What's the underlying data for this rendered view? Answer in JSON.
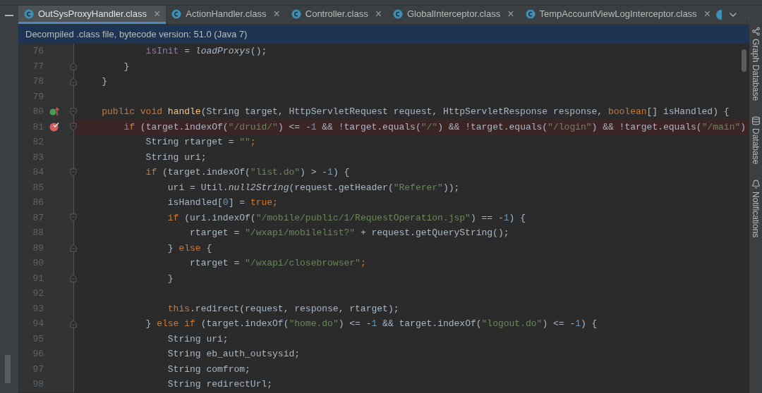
{
  "tabs": [
    {
      "label": "OutSysProxyHandler.class",
      "close": "×",
      "selected": true
    },
    {
      "label": "ActionHandler.class",
      "close": "×",
      "selected": false
    },
    {
      "label": "Controller.class",
      "close": "×",
      "selected": false
    },
    {
      "label": "GlobalInterceptor.class",
      "close": "×",
      "selected": false
    },
    {
      "label": "TempAccountViewLogInterceptor.class",
      "close": "×",
      "selected": false
    }
  ],
  "banner": "Decompiled .class file, bytecode version: 51.0 (Java 7)",
  "side_tools": [
    {
      "label": "Graph Database",
      "kind": "graph"
    },
    {
      "label": "Database",
      "kind": "database"
    },
    {
      "label": "Notifications",
      "kind": "bell"
    }
  ],
  "lines": [
    {
      "number": "76",
      "fold_start": false,
      "fold_end": false,
      "override": false,
      "breakpoint": false,
      "tokens": [
        {
          "kind": "field",
          "text": "            isInit"
        },
        {
          "kind": "plain",
          "text": " = "
        },
        {
          "kind": "call",
          "text": "loadProxys"
        },
        {
          "kind": "plain",
          "text": "();"
        }
      ]
    },
    {
      "number": "77",
      "fold_start": false,
      "fold_end": true,
      "override": false,
      "breakpoint": false,
      "tokens": [
        {
          "kind": "plain",
          "text": "        }"
        }
      ]
    },
    {
      "number": "78",
      "fold_start": false,
      "fold_end": true,
      "override": false,
      "breakpoint": false,
      "tokens": [
        {
          "kind": "plain",
          "text": "    }"
        }
      ]
    },
    {
      "number": "79",
      "fold_start": false,
      "fold_end": false,
      "override": false,
      "breakpoint": false
    },
    {
      "number": "80",
      "fold_start": true,
      "fold_end": false,
      "override": true,
      "breakpoint": false,
      "tokens": [
        {
          "kind": "kw",
          "text": "    public void "
        },
        {
          "kind": "fn",
          "text": "handle"
        },
        {
          "kind": "plain",
          "text": "(String target, HttpServletRequest request, HttpServletResponse response, "
        },
        {
          "kind": "kw",
          "text": "boolean"
        },
        {
          "kind": "plain",
          "text": "[] isHandled) {"
        }
      ]
    },
    {
      "number": "81",
      "fold_start": true,
      "fold_end": false,
      "override": false,
      "breakpoint": true,
      "tokens": [
        {
          "kind": "kw",
          "text": "        if "
        },
        {
          "kind": "plain",
          "text": "(target.indexOf("
        },
        {
          "kind": "str",
          "text": "\"/druid/\""
        },
        {
          "kind": "plain",
          "text": ") <= -"
        },
        {
          "kind": "num",
          "text": "1"
        },
        {
          "kind": "plain",
          "text": " && !target.equals("
        },
        {
          "kind": "str",
          "text": "\"/\""
        },
        {
          "kind": "plain",
          "text": ") && !target.equals("
        },
        {
          "kind": "str",
          "text": "\"/login\""
        },
        {
          "kind": "plain",
          "text": ") && !target.equals("
        },
        {
          "kind": "str",
          "text": "\"/main\""
        },
        {
          "kind": "plain",
          "text": ")"
        }
      ]
    },
    {
      "number": "82",
      "fold_start": false,
      "fold_end": false,
      "override": false,
      "breakpoint": false,
      "tokens": [
        {
          "kind": "plain",
          "text": "            String rtarget = "
        },
        {
          "kind": "str",
          "text": "\"\""
        },
        {
          "kind": "kw",
          "text": ";"
        }
      ]
    },
    {
      "number": "83",
      "fold_start": false,
      "fold_end": false,
      "override": false,
      "breakpoint": false,
      "tokens": [
        {
          "kind": "plain",
          "text": "            String uri;"
        }
      ]
    },
    {
      "number": "84",
      "fold_start": true,
      "fold_end": false,
      "override": false,
      "breakpoint": false,
      "tokens": [
        {
          "kind": "kw",
          "text": "            if "
        },
        {
          "kind": "plain",
          "text": "(target.indexOf("
        },
        {
          "kind": "str",
          "text": "\"list.do\""
        },
        {
          "kind": "plain",
          "text": ") > -"
        },
        {
          "kind": "num",
          "text": "1"
        },
        {
          "kind": "plain",
          "text": ") {"
        }
      ]
    },
    {
      "number": "85",
      "fold_start": false,
      "fold_end": false,
      "override": false,
      "breakpoint": false,
      "tokens": [
        {
          "kind": "plain",
          "text": "                uri = Util."
        },
        {
          "kind": "call",
          "text": "null2String"
        },
        {
          "kind": "plain",
          "text": "(request.getHeader("
        },
        {
          "kind": "str",
          "text": "\"Referer\""
        },
        {
          "kind": "plain",
          "text": "));"
        }
      ]
    },
    {
      "number": "86",
      "fold_start": false,
      "fold_end": false,
      "override": false,
      "breakpoint": false,
      "tokens": [
        {
          "kind": "plain",
          "text": "                isHandled["
        },
        {
          "kind": "num",
          "text": "0"
        },
        {
          "kind": "plain",
          "text": "] = "
        },
        {
          "kind": "kw",
          "text": "true;"
        }
      ]
    },
    {
      "number": "87",
      "fold_start": true,
      "fold_end": false,
      "override": false,
      "breakpoint": false,
      "tokens": [
        {
          "kind": "kw",
          "text": "                if "
        },
        {
          "kind": "plain",
          "text": "(uri.indexOf("
        },
        {
          "kind": "str",
          "text": "\"/mobile/public/1/RequestOperation.jsp\""
        },
        {
          "kind": "plain",
          "text": ") == -"
        },
        {
          "kind": "num",
          "text": "1"
        },
        {
          "kind": "plain",
          "text": ") {"
        }
      ]
    },
    {
      "number": "88",
      "fold_start": false,
      "fold_end": false,
      "override": false,
      "breakpoint": false,
      "tokens": [
        {
          "kind": "plain",
          "text": "                    rtarget = "
        },
        {
          "kind": "str",
          "text": "\"/wxapi/mobilelist?\""
        },
        {
          "kind": "plain",
          "text": " + request.getQueryString();"
        }
      ]
    },
    {
      "number": "89",
      "fold_start": false,
      "fold_end": true,
      "override": false,
      "breakpoint": false,
      "tokens": [
        {
          "kind": "plain",
          "text": "                } "
        },
        {
          "kind": "kw",
          "text": "else "
        },
        {
          "kind": "plain",
          "text": "{"
        }
      ]
    },
    {
      "number": "90",
      "fold_start": false,
      "fold_end": false,
      "override": false,
      "breakpoint": false,
      "tokens": [
        {
          "kind": "plain",
          "text": "                    rtarget = "
        },
        {
          "kind": "str",
          "text": "\"/wxapi/closebrowser\""
        },
        {
          "kind": "kw",
          "text": ";"
        }
      ]
    },
    {
      "number": "91",
      "fold_start": false,
      "fold_end": true,
      "override": false,
      "breakpoint": false,
      "tokens": [
        {
          "kind": "plain",
          "text": "                }"
        }
      ]
    },
    {
      "number": "92",
      "fold_start": false,
      "fold_end": false,
      "override": false,
      "breakpoint": false
    },
    {
      "number": "93",
      "fold_start": false,
      "fold_end": false,
      "override": false,
      "breakpoint": false,
      "tokens": [
        {
          "kind": "kw",
          "text": "                this"
        },
        {
          "kind": "plain",
          "text": ".redirect(request, response, rtarget);"
        }
      ]
    },
    {
      "number": "94",
      "fold_start": false,
      "fold_end": true,
      "override": false,
      "breakpoint": false,
      "tokens": [
        {
          "kind": "plain",
          "text": "            } "
        },
        {
          "kind": "kw",
          "text": "else if "
        },
        {
          "kind": "plain",
          "text": "(target.indexOf("
        },
        {
          "kind": "str",
          "text": "\"home.do\""
        },
        {
          "kind": "plain",
          "text": ") <= -"
        },
        {
          "kind": "num",
          "text": "1"
        },
        {
          "kind": "plain",
          "text": " && target.indexOf("
        },
        {
          "kind": "str",
          "text": "\"logout.do\""
        },
        {
          "kind": "plain",
          "text": ") <= -"
        },
        {
          "kind": "num",
          "text": "1"
        },
        {
          "kind": "plain",
          "text": ") {"
        }
      ]
    },
    {
      "number": "95",
      "fold_start": false,
      "fold_end": false,
      "override": false,
      "breakpoint": false,
      "tokens": [
        {
          "kind": "plain",
          "text": "                String uri;"
        }
      ]
    },
    {
      "number": "96",
      "fold_start": false,
      "fold_end": false,
      "override": false,
      "breakpoint": false,
      "tokens": [
        {
          "kind": "plain",
          "text": "                String eb_auth_outsysid;"
        }
      ]
    },
    {
      "number": "97",
      "fold_start": false,
      "fold_end": false,
      "override": false,
      "breakpoint": false,
      "tokens": [
        {
          "kind": "plain",
          "text": "                String comfrom;"
        }
      ]
    },
    {
      "number": "98",
      "fold_start": false,
      "fold_end": false,
      "override": false,
      "breakpoint": false,
      "tokens": [
        {
          "kind": "plain",
          "text": "                String redirectUrl;"
        }
      ]
    }
  ]
}
